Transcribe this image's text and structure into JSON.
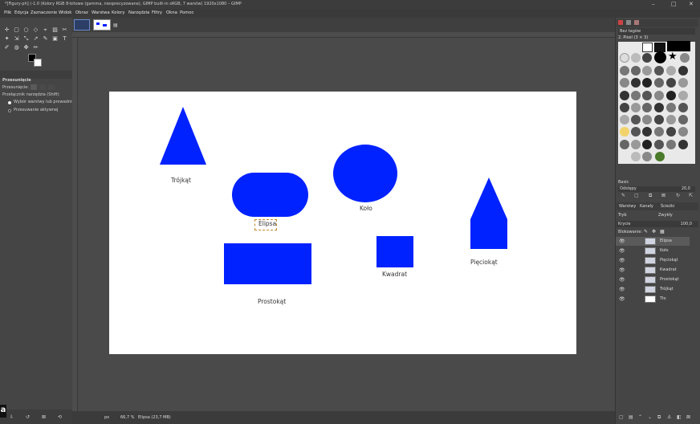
{
  "window": {
    "title": "*[Figury-ph] (-1.0 (Kolory RGB 8-bitowe (gamma, niesprecyzowane), GIMP built-in sRGB, 7 warstw) 1920x1080 – GIMP",
    "controls": [
      "–",
      "□",
      "✕"
    ]
  },
  "menu": [
    "Plik",
    "Edycja",
    "Zaznaczenie",
    "Widok",
    "Obraz",
    "Warstwa",
    "Kolory",
    "Narzędzia",
    "Filtry",
    "Okna",
    "Pomoc"
  ],
  "toolbox": {
    "tools": [
      "✛",
      "▢",
      "○",
      "◇",
      "⌖",
      "▨",
      "✂",
      "✦",
      "⇲",
      "⤡",
      "↗",
      "✎",
      "▣",
      "T",
      "✐",
      "◍",
      "✤",
      "✏"
    ],
    "colors": {
      "foreground": "#000000",
      "background": "#ffffff"
    }
  },
  "tool_options": {
    "panel_title": "Przesunięcie",
    "move_label": "Przesunięcie:",
    "switch_label": "Przełącznik narzędzia (Shift)",
    "option1": "Wybór warstwy lub prowadnicy",
    "option2": "Przesuwanie aktywnej"
  },
  "canvas": {
    "shapes": [
      {
        "label": "Trójkąt"
      },
      {
        "label": "Elipsa"
      },
      {
        "label": "Koło"
      },
      {
        "label": "Pięciokąt"
      },
      {
        "label": "Kwadrat"
      },
      {
        "label": "Prostokąt"
      }
    ],
    "shape_color": "#0022ff"
  },
  "statusbar": {
    "unit": "px",
    "zoom": "66,7 %",
    "layer_info": "Elipsa (23,7 MB)"
  },
  "right_dock": {
    "brush_filter": "Bez tagów",
    "brush_name": "2. Pixel (3 × 3)",
    "brush_category": "Basic",
    "spacing_label": "Odstępy",
    "spacing_value": "20,0",
    "tabs": [
      "Warstwy",
      "Kanały",
      "Ścieżki"
    ],
    "mode_label": "Tryb",
    "mode_value": "Zwykły",
    "opacity_label": "Krycie",
    "opacity_value": "100,0",
    "lock_label": "Blokowanie:",
    "layers": [
      "Elipsa",
      "Koło",
      "Pięciokąt",
      "Kwadrat",
      "Prostokąt",
      "Trójkąt",
      "Tło"
    ]
  }
}
